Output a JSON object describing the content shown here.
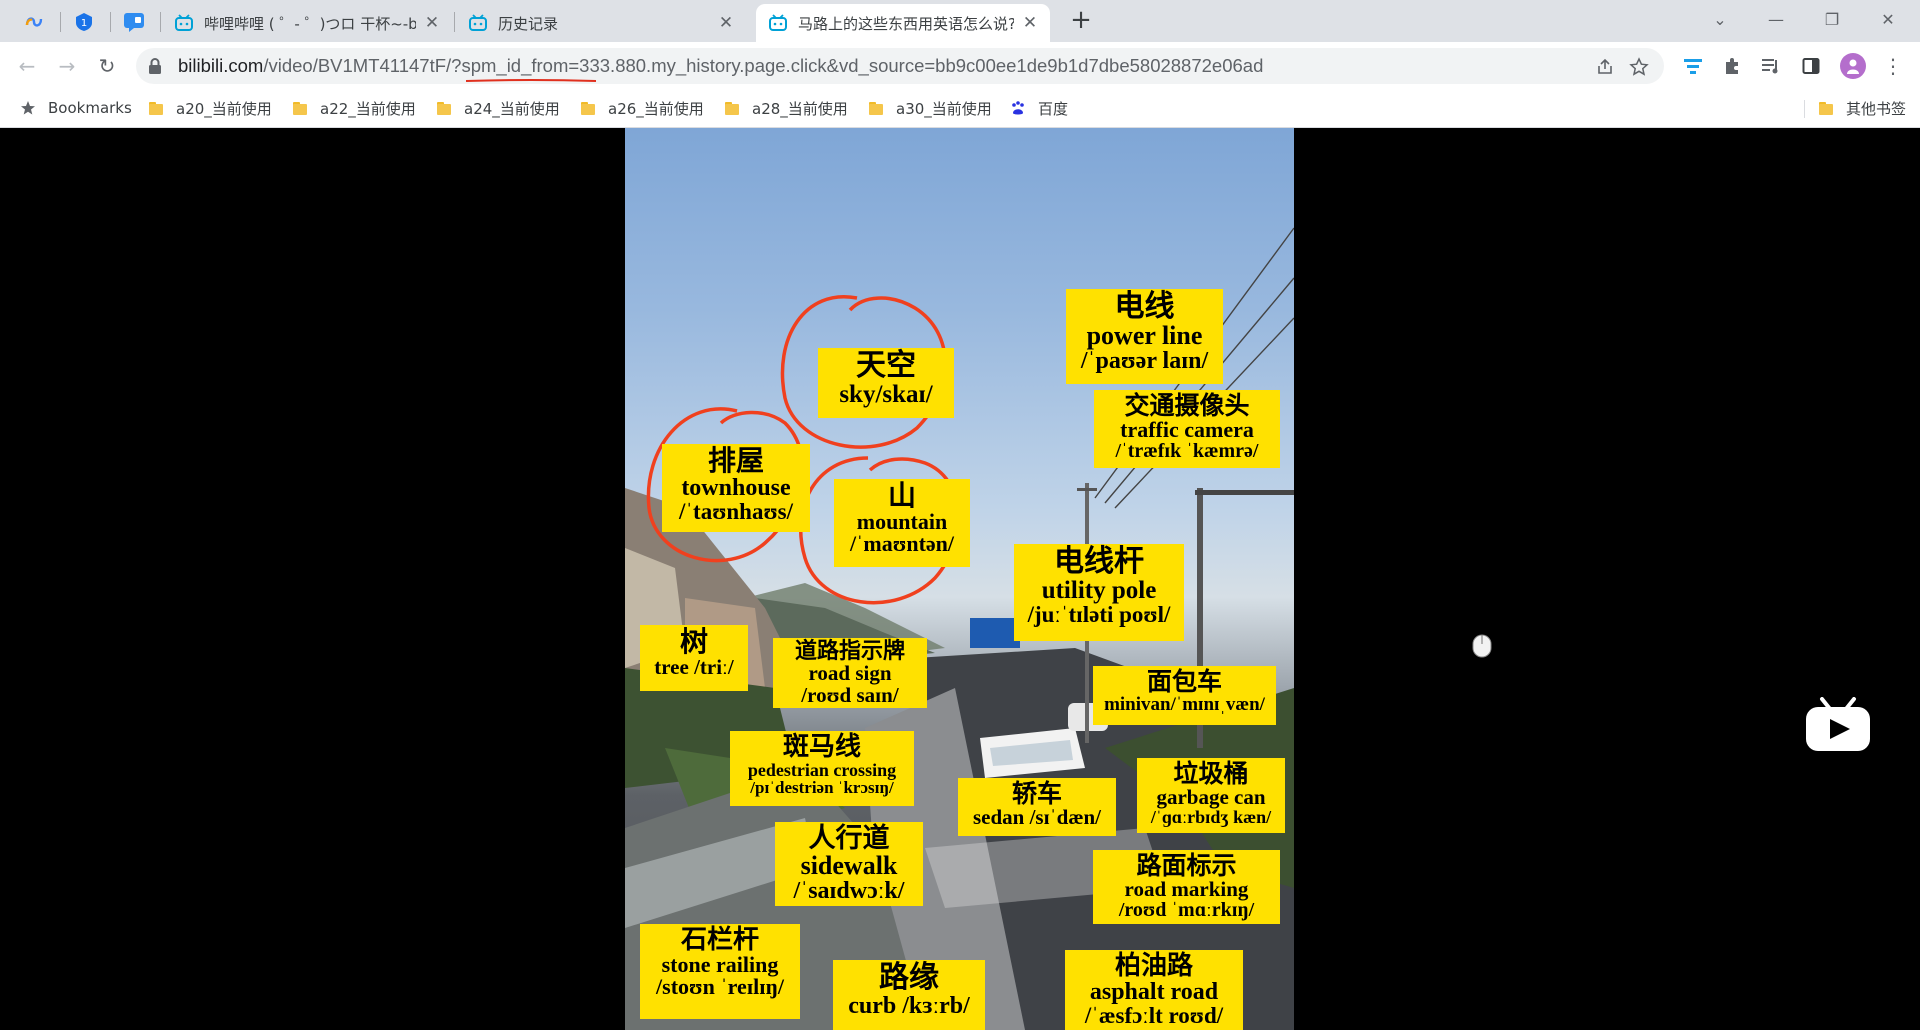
{
  "tabs": {
    "pinned": [
      {
        "name": "pinned-app-tab-1",
        "icon": "loop-icon"
      },
      {
        "name": "pinned-app-tab-2",
        "icon": "shield-icon"
      },
      {
        "name": "pinned-app-tab-3",
        "icon": "chat-icon"
      }
    ],
    "items": [
      {
        "title": "哔哩哔哩 ( ゜- ゜)つロ 干杯~-bilil",
        "icon": "bilibili-icon",
        "close": "✕"
      },
      {
        "title": "历史记录",
        "icon": "bilibili-icon",
        "close": "✕"
      },
      {
        "title": "马路上的这些东西用英语怎么说?",
        "icon": "bilibili-icon",
        "close": "✕",
        "active": true
      }
    ],
    "new_tab": "+"
  },
  "window_controls": {
    "tab_search": "⌄",
    "minimize": "—",
    "restore": "❐",
    "close": "✕"
  },
  "toolbar": {
    "back": "←",
    "forward": "→",
    "reload": "↻",
    "url_host": "bilibili.com",
    "url_rest": "/video/BV1MT41147tF/?spm_id_from=333.880.my_history.page.click&vd_source=bb9c00ee1de9b1d7dbe58028872e06ad",
    "accent_color": "#1a73e8",
    "underline_color": "#e0301e"
  },
  "bookmarks": {
    "label": "Bookmarks",
    "items": [
      "a20_当前使用",
      "a22_当前使用",
      "a24_当前使用",
      "a26_当前使用",
      "a28_当前使用",
      "a30_当前使用",
      "百度"
    ],
    "other": "其他书签"
  },
  "video": {
    "label_color": "#ffe100",
    "circle_color": "#f0401e",
    "labels": [
      {
        "zh": "电线",
        "en": "power line",
        "ipa": "/ˈpaʊər laɪn/"
      },
      {
        "zh": "天空",
        "en": "sky/skaɪ/",
        "ipa": ""
      },
      {
        "zh": "交通摄像头",
        "en": "traffic camera",
        "ipa": "/ˈtræfɪk ˈkæmrə/"
      },
      {
        "zh": "排屋",
        "en": "townhouse",
        "ipa": "/ˈtaʊnhaʊs/"
      },
      {
        "zh": "山",
        "en": "mountain",
        "ipa": "/ˈmaʊntən/"
      },
      {
        "zh": "电线杆",
        "en": "utility pole",
        "ipa": "/juːˈtɪləti poʊl/"
      },
      {
        "zh": "树",
        "en": "tree /triː/",
        "ipa": ""
      },
      {
        "zh": "道路指示牌",
        "en": "road sign",
        "ipa": "/roʊd saɪn/"
      },
      {
        "zh": "面包车",
        "en": "minivan/ˈmɪnɪˌvæn/",
        "ipa": ""
      },
      {
        "zh": "斑马线",
        "en": "pedestrian crossing",
        "ipa": "/pɪˈdestriən ˈkrɔsɪŋ/"
      },
      {
        "zh": "轿车",
        "en": "sedan /sɪˈdæn/",
        "ipa": ""
      },
      {
        "zh": "垃圾桶",
        "en": "garbage can",
        "ipa": "/ˈɡɑːrbɪdʒ kæn/"
      },
      {
        "zh": "人行道",
        "en": "sidewalk",
        "ipa": "/ˈsaɪdwɔːk/"
      },
      {
        "zh": "路面标示",
        "en": "road marking",
        "ipa": "/roʊd ˈmɑːrkɪŋ/"
      },
      {
        "zh": "石栏杆",
        "en": "stone railing",
        "ipa": "/stoʊn ˈreɪlɪŋ/"
      },
      {
        "zh": "路缘",
        "en": "curb /kɜːrb/",
        "ipa": ""
      },
      {
        "zh": "柏油路",
        "en": "asphalt road",
        "ipa": "/ˈæsfɔːlt roʊd/"
      }
    ]
  }
}
